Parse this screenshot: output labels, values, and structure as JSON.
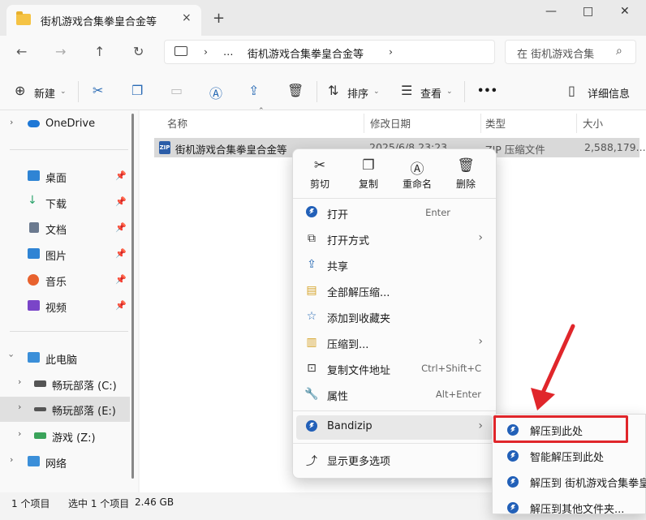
{
  "tab": {
    "title": "街机游戏合集拳皇合金等",
    "close": "×",
    "new": "+"
  },
  "window": {
    "minimize": "—",
    "maximize": "□",
    "close": "✕"
  },
  "nav": {
    "back": "←",
    "forward": "→",
    "up": "↑",
    "refresh": "↻"
  },
  "address": {
    "sep1": "›",
    "ellipsis": "…",
    "folder": "街机游戏合集拳皇合金等",
    "sep2": "›"
  },
  "search": {
    "placeholder": "在 街机游戏合集...",
    "display": "在 街机游戏合集"
  },
  "toolbar": {
    "new": "新建",
    "sort": "排序",
    "view": "查看",
    "more": "•••",
    "details": "详细信息"
  },
  "sidebar": {
    "onedrive": "OneDrive",
    "quick": [
      {
        "label": "桌面",
        "color": "#2f84d4"
      },
      {
        "label": "下载",
        "color": "#2aa36b"
      },
      {
        "label": "文档",
        "color": "#6b7a8f"
      },
      {
        "label": "图片",
        "color": "#2f84d4"
      },
      {
        "label": "音乐",
        "color": "#e8622e"
      },
      {
        "label": "视频",
        "color": "#7a45c8"
      }
    ],
    "thispc": "此电脑",
    "drives": [
      {
        "label": "畅玩部落 (C:)"
      },
      {
        "label": "畅玩部落 (E:)"
      },
      {
        "label": "游戏 (Z:)"
      }
    ],
    "network": "网络"
  },
  "columns": {
    "name": "名称",
    "date": "修改日期",
    "type": "类型",
    "size": "大小"
  },
  "file": {
    "name": "街机游戏合集拳皇合金等",
    "date": "2025/6/8 23:23",
    "type": "ZIP 压缩文件",
    "size": "2,588,179...",
    "badge": "ZIP"
  },
  "status": {
    "items": "1 个项目",
    "selected": "选中 1 个项目",
    "size": "2.46 GB"
  },
  "context": {
    "quick": {
      "cut": "剪切",
      "copy": "复制",
      "rename": "重命名",
      "delete": "删除"
    },
    "open": "打开",
    "open_sc": "Enter",
    "open_with": "打开方式",
    "share": "共享",
    "extract_all": "全部解压缩...",
    "favorite": "添加到收藏夹",
    "compress": "压缩到...",
    "copy_path": "复制文件地址",
    "copy_path_sc": "Ctrl+Shift+C",
    "properties": "属性",
    "properties_sc": "Alt+Enter",
    "bandizip": "Bandizip",
    "more": "显示更多选项"
  },
  "submenu": {
    "extract_here": "解压到此处",
    "smart_extract": "智能解压到此处",
    "extract_to": "解压到 街机游戏合集拳皇合",
    "extract_other": "解压到其他文件夹..."
  },
  "colors": {
    "highlight": "#e0262b",
    "accent": "#2260b8"
  }
}
